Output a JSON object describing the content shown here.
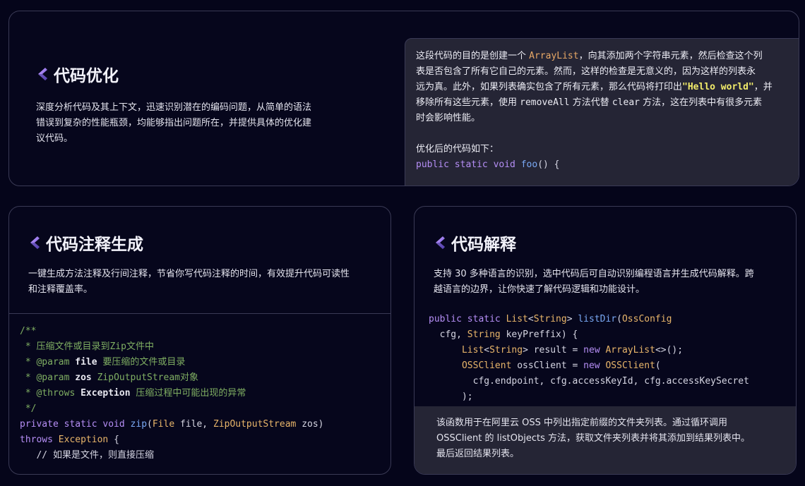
{
  "card1": {
    "title": "代码优化",
    "desc_lines": [
      "深度分析代码及其上下文，迅速识别潜在的编码问题，从简单的语法",
      "错误到复杂的性能瓶颈，均能够指出问题所在，并提供具体的优化建",
      "议代码。"
    ],
    "panel": {
      "p1_a": "这段代码的目的是创建一个 ",
      "p1_code": "ArrayList",
      "p1_b": "，向其添加两个字符串元素，然后检查这个列",
      "p2": "表是否包含了所有它自己的元素。然而，这样的检查是无意义的，因为这样的列表永",
      "p3_a": "远为真。此外，如果列表确实包含了所有元素，那么代码将打印出",
      "p3_code": "\"Hello world\"",
      "p3_b": "，并",
      "p4_a": "移除所有这些元素，使用 ",
      "p4_code1": "removeAll",
      "p4_b": " 方法代替 ",
      "p4_code2": "clear",
      "p4_c": " 方法，这在列表中有很多元素",
      "p5": "时会影响性能。",
      "optimized_label": "优化后的代码如下：",
      "code_kw": "public static void",
      "code_fn": "foo",
      "code_rest": "() {"
    }
  },
  "card2": {
    "title": "代码注释生成",
    "desc_lines": [
      "一键生成方法注释及行间注释，节省你写代码注释的时间，有效提升代码可读性",
      "和注释覆盖率。"
    ],
    "code": {
      "l1": "/**",
      "l2": " * 压缩文件或目录到Zip文件中",
      "l3_tag": " * @param ",
      "l3_name": "file",
      "l3_desc": " 要压缩的文件或目录",
      "l4_tag": " * @param ",
      "l4_name": "zos",
      "l4_desc": " ZipOutputStream对象",
      "l5_tag": " * @throws ",
      "l5_name": "Exception",
      "l5_desc": " 压缩过程中可能出现的异常",
      "l6": " */",
      "l7_kw": "private static void ",
      "l7_fn": "zip",
      "l7_p1": "(",
      "l7_t1": "File",
      "l7_p2": " file, ",
      "l7_t2": "ZipOutputStream",
      "l7_p3": " zos)",
      "l8_kw": "throws ",
      "l8_t": "Exception",
      "l8_p": " {",
      "l9": "   // 如果是文件，则直接压缩"
    }
  },
  "card3": {
    "title": "代码解释",
    "desc_lines": [
      "支持 30 多种语言的识别，选中代码后可自动识别编程语言并生成代码解释。跨",
      "越语言的边界，让你快速了解代码逻辑和功能设计。"
    ],
    "code": {
      "l1_kw": "public static ",
      "l1_t": "List",
      "l1_p1": "<",
      "l1_t2": "String",
      "l1_p2": "> ",
      "l1_fn": "listDir",
      "l1_p3": "(",
      "l1_t3": "OssConfig",
      "l2_p1": "  cfg, ",
      "l2_t": "String",
      "l2_p2": " keyPreffix) {",
      "l3_t": "      List",
      "l3_p1": "<",
      "l3_t2": "String",
      "l3_p2": "> result = ",
      "l3_kw": "new ",
      "l3_t3": "ArrayList",
      "l3_p3": "<>();",
      "l4_t": "      OSSClient",
      "l4_p1": " ossClient = ",
      "l4_kw": "new ",
      "l4_t2": "OSSClient",
      "l4_p2": "(",
      "l5": "        cfg.endpoint, cfg.accessKeyId, cfg.accessKeySecret",
      "l6": "      );"
    },
    "explain_lines": [
      "该函数用于在阿里云 OSS 中列出指定前缀的文件夹列表。通过循环调用",
      "OSSClient 的 listObjects 方法，获取文件夹列表并将其添加到结果列表中。",
      "最后返回结果列表。"
    ]
  }
}
